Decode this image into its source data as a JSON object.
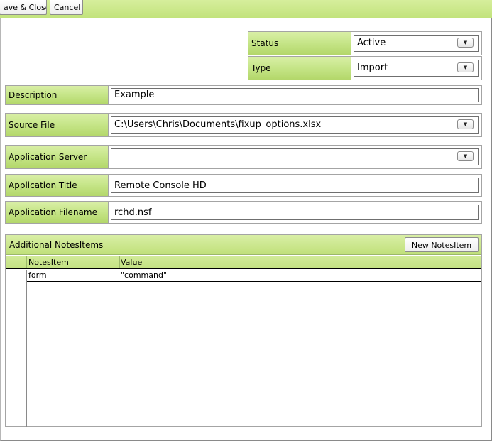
{
  "toolbar": {
    "save_close_label": "ave & Close",
    "cancel_label": "Cancel"
  },
  "form": {
    "status": {
      "label": "Status",
      "value": "Active"
    },
    "type": {
      "label": "Type",
      "value": "Import"
    },
    "description": {
      "label": "Description",
      "value": "Example"
    },
    "source_file": {
      "label": "Source File",
      "value": "C:\\Users\\Chris\\Documents\\fixup_options.xlsx"
    },
    "application_server": {
      "label": "Application Server",
      "value": ""
    },
    "application_title": {
      "label": "Application Title",
      "value": "Remote Console HD"
    },
    "application_filename": {
      "label": "Application Filename",
      "value": "rchd.nsf"
    }
  },
  "notes_items": {
    "title": "Additional NotesItems",
    "new_button_label": "New NotesItem",
    "columns": [
      "NotesItem",
      "Value"
    ],
    "rows": [
      {
        "item": "form",
        "value": "\"command\""
      }
    ]
  },
  "icons": {
    "dropdown": "dropdown-arrow-icon"
  }
}
